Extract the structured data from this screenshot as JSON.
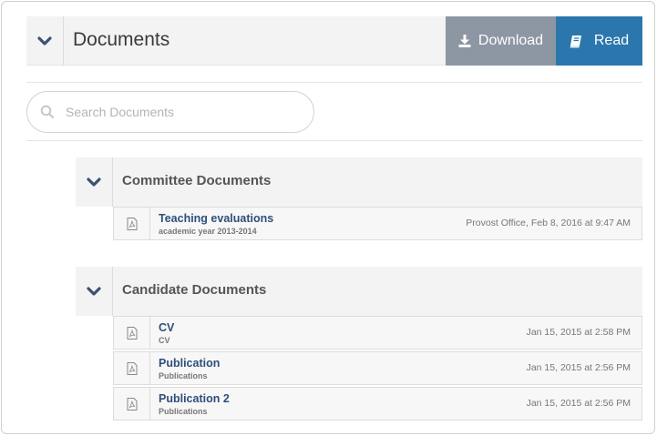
{
  "header": {
    "title": "Documents",
    "download_label": "Download",
    "read_label": "Read"
  },
  "search": {
    "placeholder": "Search Documents"
  },
  "sections": [
    {
      "title": "Committee Documents",
      "documents": [
        {
          "name": "Teaching evaluations",
          "subtitle": "academic year 2013-2014",
          "meta": "Provost Office, Feb 8, 2016 at 9:47 AM"
        }
      ]
    },
    {
      "title": "Candidate Documents",
      "documents": [
        {
          "name": "CV",
          "subtitle": "CV",
          "meta": "Jan 15, 2015 at 2:58 PM"
        },
        {
          "name": "Publication",
          "subtitle": "Publications",
          "meta": "Jan 15, 2015 at 2:56 PM"
        },
        {
          "name": "Publication 2",
          "subtitle": "Publications",
          "meta": "Jan 15, 2015 at 2:56 PM"
        }
      ]
    }
  ],
  "colors": {
    "accent": "#2b77ad",
    "download_bg": "#8d97a3",
    "chevron": "#3d5175",
    "link": "#2e4f7a"
  },
  "icons": [
    "chevron-down-icon",
    "download-icon",
    "book-icon",
    "search-icon",
    "pdf-file-icon"
  ]
}
